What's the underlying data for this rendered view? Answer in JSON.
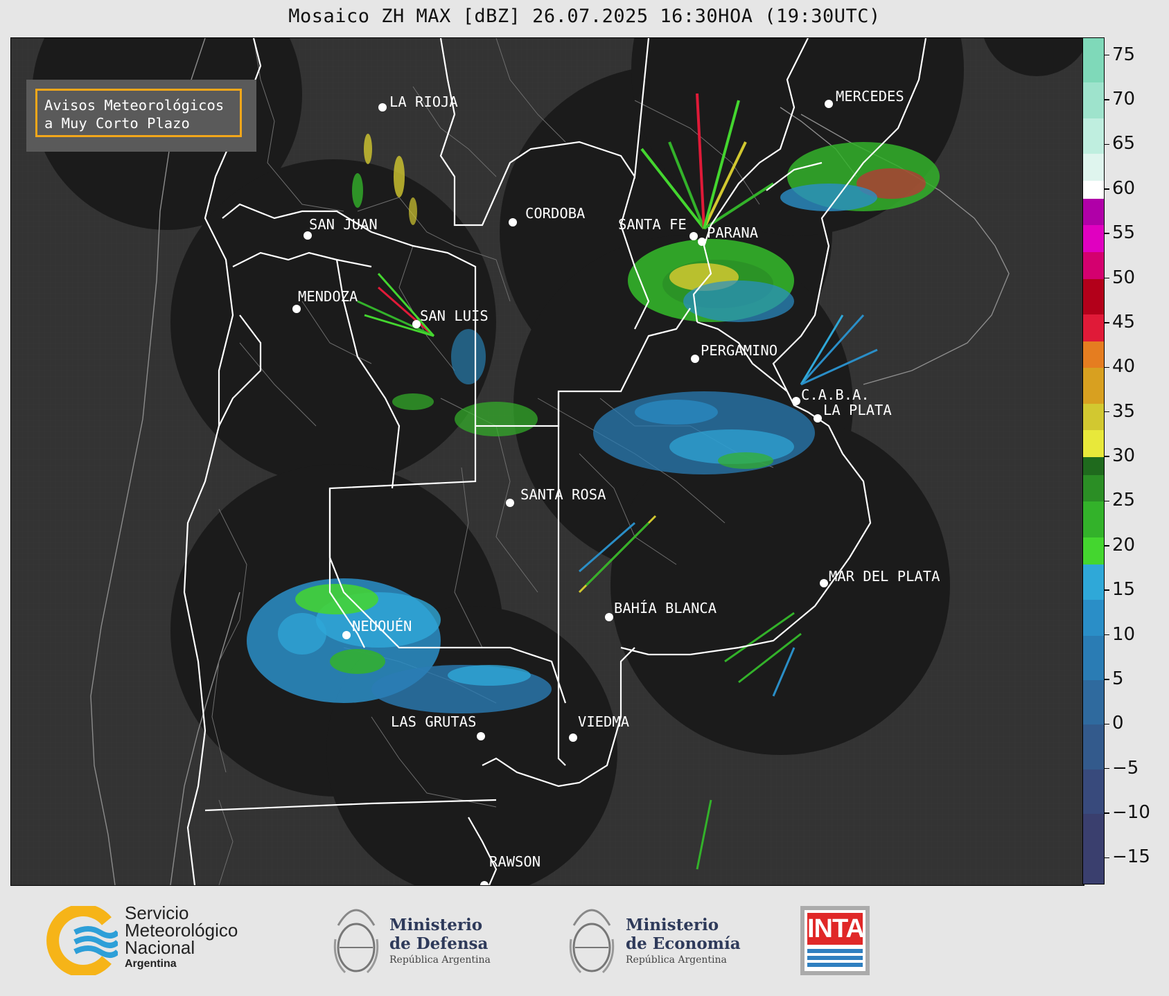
{
  "title": "Mosaico ZH MAX [dBZ] 26.07.2025 16:30HOA (19:30UTC)",
  "notice": {
    "line1": "Avisos Meteorológicos",
    "line2": "a Muy Corto Plazo"
  },
  "cities": [
    {
      "name": "LA RIOJA"
    },
    {
      "name": "CORDOBA"
    },
    {
      "name": "SAN JUAN"
    },
    {
      "name": "SANTA FE"
    },
    {
      "name": "PARANA"
    },
    {
      "name": "MERCEDES"
    },
    {
      "name": "MENDOZA"
    },
    {
      "name": "SAN LUIS"
    },
    {
      "name": "PERGAMINO"
    },
    {
      "name": "C.A.B.A."
    },
    {
      "name": "LA PLATA"
    },
    {
      "name": "SANTA ROSA"
    },
    {
      "name": "MAR DEL PLATA"
    },
    {
      "name": "BAHÍA BLANCA"
    },
    {
      "name": "NEUQUÉN"
    },
    {
      "name": "LAS GRUTAS"
    },
    {
      "name": "VIEDMA"
    },
    {
      "name": "RAWSON"
    }
  ],
  "colorbar": {
    "unit": "dBZ",
    "min": -18,
    "max": 77,
    "ticks": [
      "75",
      "70",
      "65",
      "60",
      "55",
      "50",
      "45",
      "40",
      "35",
      "30",
      "25",
      "20",
      "15",
      "10",
      "5",
      "0",
      "−5",
      "−10",
      "−15"
    ],
    "tick_values": [
      75,
      70,
      65,
      60,
      55,
      50,
      45,
      40,
      35,
      30,
      25,
      20,
      15,
      10,
      5,
      0,
      -5,
      -10,
      -15
    ],
    "bands": [
      {
        "from": -18,
        "to": -10,
        "color": "#3a3f6e"
      },
      {
        "from": -10,
        "to": -5,
        "color": "#384a7c"
      },
      {
        "from": -5,
        "to": 0,
        "color": "#335a8c"
      },
      {
        "from": 0,
        "to": 5,
        "color": "#2f6a9e"
      },
      {
        "from": 5,
        "to": 10,
        "color": "#2a7cb4"
      },
      {
        "from": 10,
        "to": 14,
        "color": "#2a8ec7"
      },
      {
        "from": 14,
        "to": 18,
        "color": "#2fa8d8"
      },
      {
        "from": 18,
        "to": 21,
        "color": "#44d62f"
      },
      {
        "from": 21,
        "to": 25,
        "color": "#33b22a"
      },
      {
        "from": 25,
        "to": 28,
        "color": "#2b8e25"
      },
      {
        "from": 28,
        "to": 30,
        "color": "#1f6a1d"
      },
      {
        "from": 30,
        "to": 33,
        "color": "#e8e83a"
      },
      {
        "from": 33,
        "to": 36,
        "color": "#d2c830"
      },
      {
        "from": 36,
        "to": 40,
        "color": "#d8a020"
      },
      {
        "from": 40,
        "to": 43,
        "color": "#e57d20"
      },
      {
        "from": 43,
        "to": 46,
        "color": "#e01a38"
      },
      {
        "from": 46,
        "to": 50,
        "color": "#b3001a"
      },
      {
        "from": 50,
        "to": 53,
        "color": "#d4006f"
      },
      {
        "from": 53,
        "to": 56,
        "color": "#e000c0"
      },
      {
        "from": 56,
        "to": 59,
        "color": "#b000a8"
      },
      {
        "from": 59,
        "to": 61,
        "color": "#ffffff"
      },
      {
        "from": 61,
        "to": 64,
        "color": "#dff5ee"
      },
      {
        "from": 64,
        "to": 68,
        "color": "#bfeedf"
      },
      {
        "from": 68,
        "to": 72,
        "color": "#9ee3cc"
      },
      {
        "from": 72,
        "to": 77,
        "color": "#7fd9b9"
      }
    ]
  },
  "footer": {
    "smn": {
      "line1": "Servicio",
      "line2": "Meteorológico",
      "line3": "Nacional",
      "line4": "Argentina"
    },
    "defensa": {
      "line1": "Ministerio",
      "line2": "de Defensa",
      "line3": "República Argentina"
    },
    "economia": {
      "line1": "Ministerio",
      "line2": "de Economía",
      "line3": "República Argentina"
    },
    "inta": {
      "text": "INTA"
    }
  },
  "colors": {
    "map_bg": "#333333",
    "radar_bg": "#1b1b1b",
    "notice_border": "#f3a71a"
  }
}
